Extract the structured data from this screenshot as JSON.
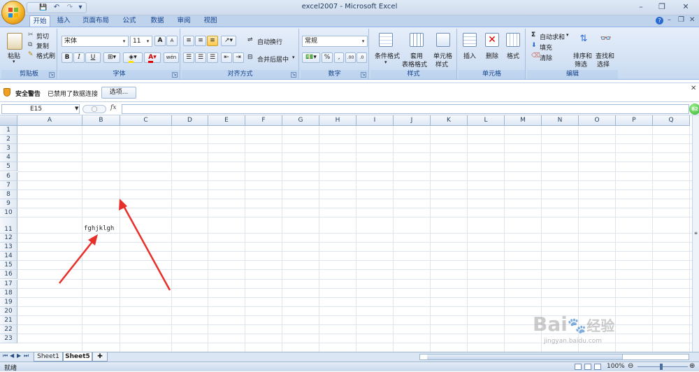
{
  "window": {
    "title": "excel2007 - Microsoft Excel",
    "minimize": "–",
    "restore": "❐",
    "close": "✕"
  },
  "qat": {
    "save": "💾",
    "undo": "↶",
    "redo": "↷",
    "more": "▾"
  },
  "tabs": [
    {
      "label": "开始",
      "active": true
    },
    {
      "label": "插入"
    },
    {
      "label": "页面布局"
    },
    {
      "label": "公式"
    },
    {
      "label": "数据"
    },
    {
      "label": "审阅"
    },
    {
      "label": "视图"
    }
  ],
  "ribbon": {
    "clipboard": {
      "title": "剪贴板",
      "paste": "粘贴",
      "cut": "剪切",
      "copy": "复制",
      "format_painter": "格式刷"
    },
    "font": {
      "title": "字体",
      "font_name": "宋体",
      "font_size": "11",
      "bold": "B",
      "italic": "I",
      "underline": "U",
      "grow": "A",
      "shrink": "A",
      "wen": "wén"
    },
    "alignment": {
      "title": "对齐方式",
      "wrap": "自动换行",
      "merge": "合并后居中"
    },
    "number": {
      "title": "数字",
      "format": "常规",
      "percent": "%",
      "comma": ","
    },
    "styles": {
      "title": "样式",
      "conditional": "条件格式",
      "table_line1": "套用",
      "table_line2": "表格格式",
      "cell_line1": "单元格",
      "cell_line2": "样式"
    },
    "cells": {
      "title": "单元格",
      "insert": "插入",
      "delete": "删除",
      "format": "格式"
    },
    "editing": {
      "title": "编辑",
      "autosum": "自动求和",
      "fill": "填充",
      "clear": "清除",
      "sort_line1": "排序和",
      "sort_line2": "筛选",
      "find_line1": "查找和",
      "find_line2": "选择"
    }
  },
  "security": {
    "title": "安全警告",
    "message": "已禁用了数据连接",
    "options": "选项..."
  },
  "formula": {
    "name_box": "E15",
    "fx": "fx",
    "value": ""
  },
  "sheet": {
    "columns": [
      "A",
      "B",
      "C",
      "D",
      "E",
      "F",
      "G",
      "H",
      "I",
      "J",
      "K",
      "L",
      "M",
      "N",
      "O",
      "P",
      "Q"
    ],
    "rows": [
      "1",
      "2",
      "3",
      "4",
      "5",
      "6",
      "7",
      "8",
      "9",
      "10",
      "11",
      "12",
      "13",
      "14",
      "15",
      "16",
      "17",
      "18",
      "19",
      "20",
      "21",
      "22",
      "23"
    ],
    "cell_b11": "fghjklgh"
  },
  "sheet_tabs": [
    {
      "label": "Sheet1"
    },
    {
      "label": "Sheet5",
      "active": true
    }
  ],
  "status": {
    "ready": "就绪",
    "zoom": "100%"
  },
  "badge": "62",
  "watermark": {
    "brand": "Bai",
    "brand_cn": "经验",
    "url": "jingyan.baidu.com"
  },
  "colors": {
    "arrow": "#e8302a",
    "accent": "#15428b"
  }
}
